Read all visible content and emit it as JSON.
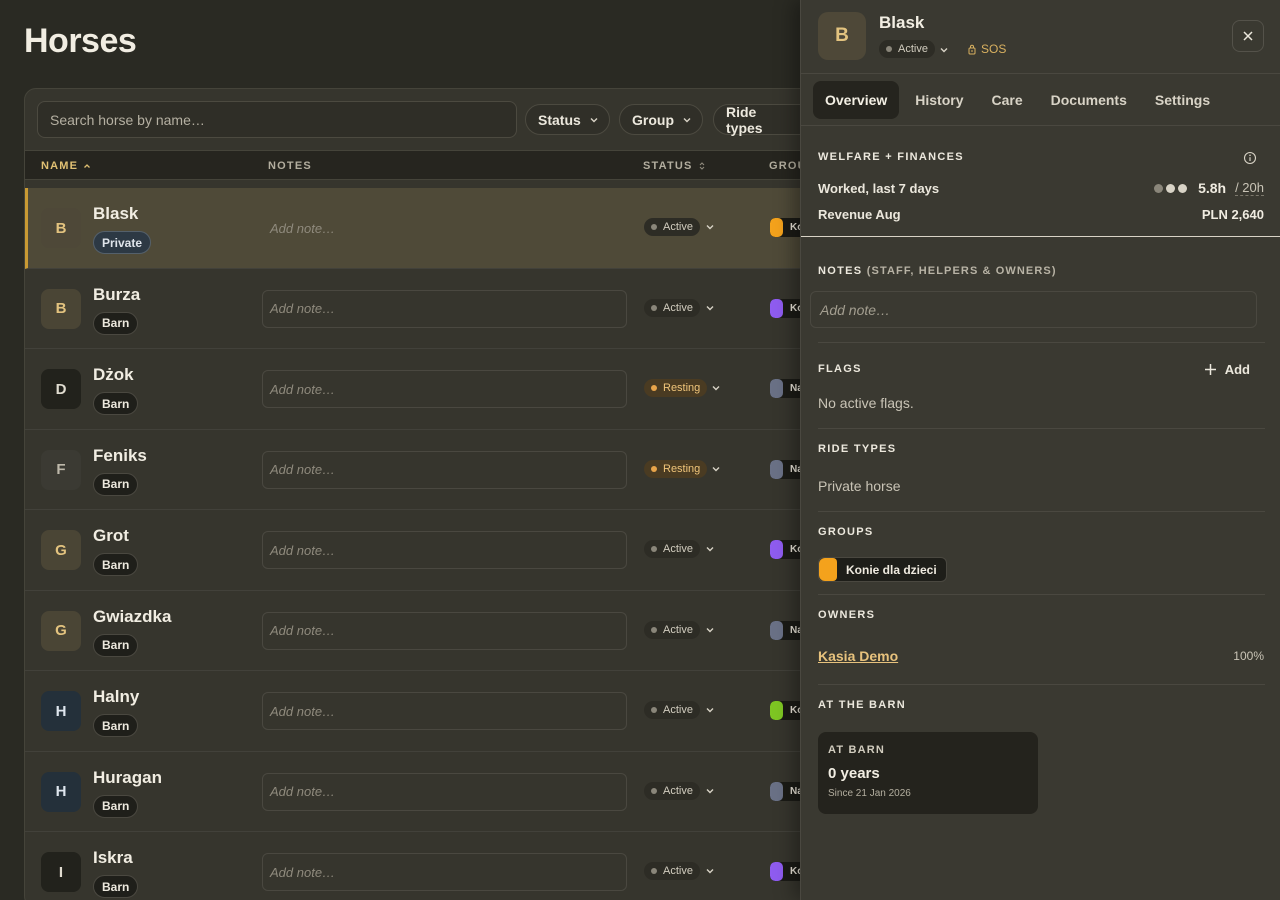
{
  "page": {
    "title": "Horses"
  },
  "toolbar": {
    "search_placeholder": "Search horse by name…",
    "filters": [
      "Status",
      "Group",
      "Ride types"
    ]
  },
  "table": {
    "headers": {
      "name": "NAME",
      "notes": "NOTES",
      "status": "STATUS",
      "group": "GROU"
    },
    "note_placeholder": "Add note…",
    "rows": [
      {
        "initial": "B",
        "name": "Blask",
        "badge": "Private",
        "status": "Active",
        "group_color": "#f4a21c",
        "group_short": "Ko",
        "selected": true,
        "avatar_bg": "#4e4838",
        "avatar_fg": "#e3c37f"
      },
      {
        "initial": "B",
        "name": "Burza",
        "badge": "Barn",
        "status": "Active",
        "group_color": "#8f5cf0",
        "group_short": "Ko",
        "avatar_bg": "#4a4535",
        "avatar_fg": "#e3c37f"
      },
      {
        "initial": "D",
        "name": "Dżok",
        "badge": "Barn",
        "status": "Resting",
        "group_color": "#6a7186",
        "group_short": "Na",
        "avatar_bg": "#22221c",
        "avatar_fg": "#e0dcd0"
      },
      {
        "initial": "F",
        "name": "Feniks",
        "badge": "Barn",
        "status": "Resting",
        "group_color": "#6a7186",
        "group_short": "Na",
        "avatar_bg": "#3b3a33",
        "avatar_fg": "#bdb8aa"
      },
      {
        "initial": "G",
        "name": "Grot",
        "badge": "Barn",
        "status": "Active",
        "group_color": "#8f5cf0",
        "group_short": "Ko",
        "avatar_bg": "#4a4535",
        "avatar_fg": "#e3c37f"
      },
      {
        "initial": "G",
        "name": "Gwiazdka",
        "badge": "Barn",
        "status": "Active",
        "group_color": "#6a7186",
        "group_short": "Na",
        "avatar_bg": "#4a4535",
        "avatar_fg": "#e3c37f"
      },
      {
        "initial": "H",
        "name": "Halny",
        "badge": "Barn",
        "status": "Active",
        "group_color": "#7ec623",
        "group_short": "Ko",
        "avatar_bg": "#24303a",
        "avatar_fg": "#dfe6ee"
      },
      {
        "initial": "H",
        "name": "Huragan",
        "badge": "Barn",
        "status": "Active",
        "group_color": "#6a7186",
        "group_short": "Na",
        "avatar_bg": "#24303a",
        "avatar_fg": "#dfe6ee"
      },
      {
        "initial": "I",
        "name": "Iskra",
        "badge": "Barn",
        "status": "Active",
        "group_color": "#8f5cf0",
        "group_short": "Ko",
        "avatar_bg": "#22221c",
        "avatar_fg": "#e0dcd0"
      }
    ]
  },
  "panel": {
    "initial": "B",
    "name": "Blask",
    "status": "Active",
    "sos": "SOS",
    "tabs": [
      "Overview",
      "History",
      "Care",
      "Documents",
      "Settings"
    ],
    "welfare": {
      "title": "WELFARE + FINANCES",
      "worked_label": "Worked, last 7 days",
      "worked_value": "5.8h",
      "worked_limit": "/ 20h",
      "revenue_label": "Revenue Aug",
      "revenue_value": "PLN 2,640"
    },
    "notes": {
      "title": "NOTES",
      "sub": "(STAFF, HELPERS & OWNERS)",
      "placeholder": "Add note…"
    },
    "flags": {
      "title": "FLAGS",
      "add_label": "Add",
      "empty": "No active flags."
    },
    "ride_types": {
      "title": "RIDE TYPES",
      "value": "Private horse"
    },
    "groups": {
      "title": "GROUPS",
      "items": [
        "Konie dla dzieci"
      ]
    },
    "owners": {
      "title": "OWNERS",
      "name": "Kasia Demo",
      "share": "100%"
    },
    "barn": {
      "title": "AT THE BARN",
      "card_label": "AT BARN",
      "card_value": "0 years",
      "card_since": "Since 21 Jan 2026"
    }
  },
  "colors": {
    "accent": "#e0c073",
    "group_orange": "#f4a21c"
  }
}
